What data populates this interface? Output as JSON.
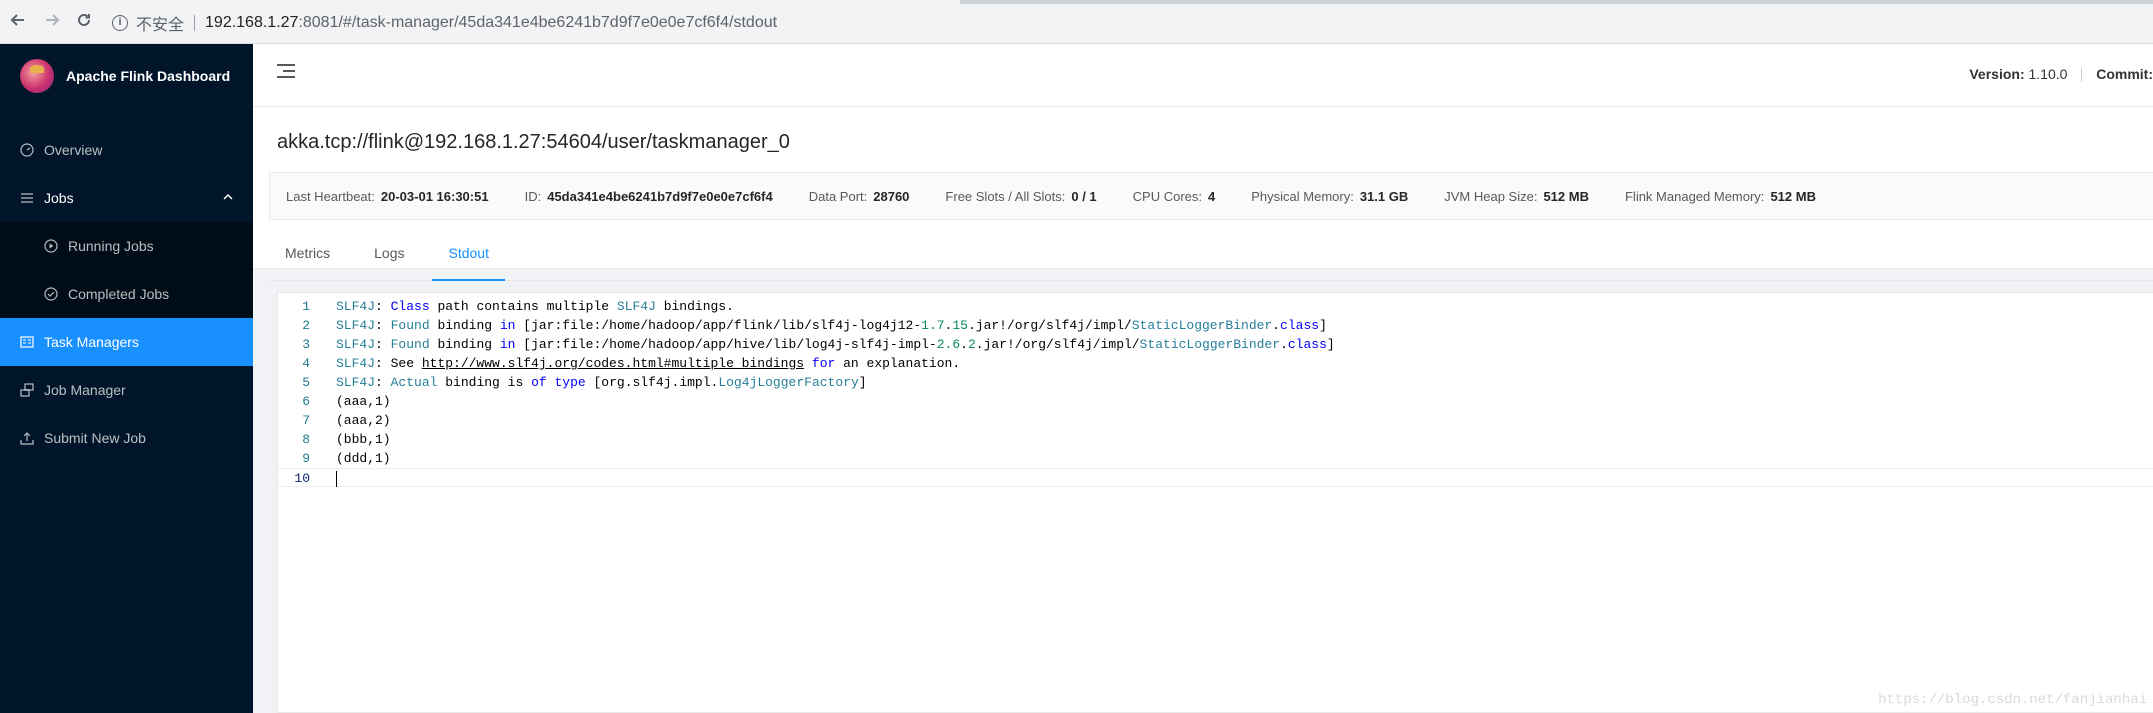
{
  "browser": {
    "back_icon": "arrow-left-icon",
    "forward_icon": "arrow-right-icon",
    "reload_icon": "reload-icon",
    "insecure_label": "不安全",
    "url_host": "192.168.1.27",
    "url_path": ":8081/#/task-manager/45da341e4be6241b7d9f7e0e0e7cf6f4/stdout"
  },
  "sidebar": {
    "app_title": "Apache Flink Dashboard",
    "items": [
      {
        "label": "Overview",
        "icon": "dashboard-icon"
      },
      {
        "label": "Jobs",
        "icon": "list-icon"
      },
      {
        "label": "Running Jobs",
        "icon": "play-circle-icon"
      },
      {
        "label": "Completed Jobs",
        "icon": "check-circle-icon"
      },
      {
        "label": "Task Managers",
        "icon": "schedule-icon"
      },
      {
        "label": "Job Manager",
        "icon": "cluster-icon"
      },
      {
        "label": "Submit New Job",
        "icon": "upload-icon"
      }
    ],
    "active_color": "#1890ff",
    "background": "#001529"
  },
  "header": {
    "version_label": "Version:",
    "version_value": "1.10.0",
    "commit_label": "Commit:"
  },
  "taskmanager": {
    "title": "akka.tcp://flink@192.168.1.27:54604/user/taskmanager_0",
    "details": [
      {
        "label": "Last Heartbeat:",
        "value": "20-03-01 16:30:51"
      },
      {
        "label": "ID:",
        "value": "45da341e4be6241b7d9f7e0e0e7cf6f4"
      },
      {
        "label": "Data Port:",
        "value": "28760"
      },
      {
        "label": "Free Slots / All Slots:",
        "value": "0 / 1"
      },
      {
        "label": "CPU Cores:",
        "value": "4"
      },
      {
        "label": "Physical Memory:",
        "value": "31.1 GB"
      },
      {
        "label": "JVM Heap Size:",
        "value": "512 MB"
      },
      {
        "label": "Flink Managed Memory:",
        "value": "512 MB"
      }
    ],
    "tabs": [
      "Metrics",
      "Logs",
      "Stdout"
    ],
    "active_tab": "Stdout"
  },
  "stdout": {
    "lines": [
      {
        "n": "1",
        "text": "SLF4J: Class path contains multiple SLF4J bindings."
      },
      {
        "n": "2",
        "text": "SLF4J: Found binding in [jar:file:/home/hadoop/app/flink/lib/slf4j-log4j12-1.7.15.jar!/org/slf4j/impl/StaticLoggerBinder.class]"
      },
      {
        "n": "3",
        "text": "SLF4J: Found binding in [jar:file:/home/hadoop/app/hive/lib/log4j-slf4j-impl-2.6.2.jar!/org/slf4j/impl/StaticLoggerBinder.class]"
      },
      {
        "n": "4",
        "text": "SLF4J: See http://www.slf4j.org/codes.html#multiple_bindings for an explanation."
      },
      {
        "n": "5",
        "text": "SLF4J: Actual binding is of type [org.slf4j.impl.Log4jLoggerFactory]"
      },
      {
        "n": "6",
        "text": "(aaa,1)"
      },
      {
        "n": "7",
        "text": "(aaa,2)"
      },
      {
        "n": "8",
        "text": "(bbb,1)"
      },
      {
        "n": "9",
        "text": "(ddd,1)"
      },
      {
        "n": "10",
        "text": ""
      }
    ]
  },
  "watermark": "https://blog.csdn.net/fanjianhai"
}
